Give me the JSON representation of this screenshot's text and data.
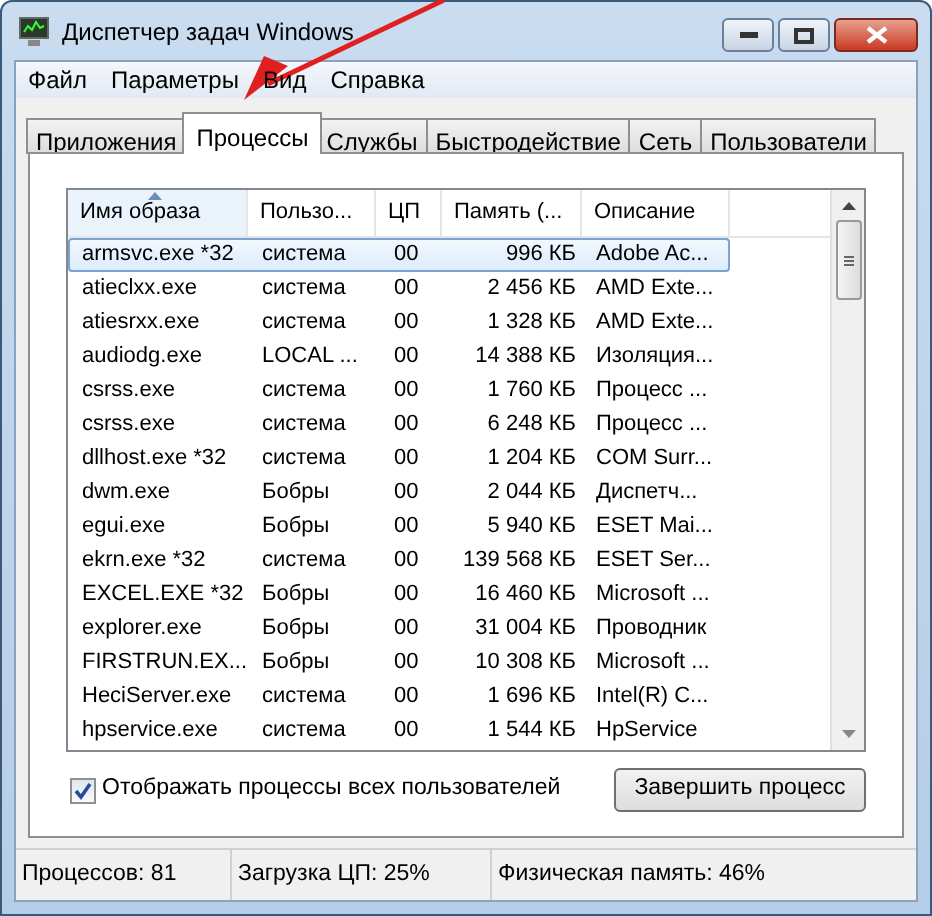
{
  "window": {
    "title": "Диспетчер задач Windows"
  },
  "menu": [
    "Файл",
    "Параметры",
    "Вид",
    "Справка"
  ],
  "tabs": [
    {
      "label": "Приложения",
      "selected": false
    },
    {
      "label": "Процессы",
      "selected": true
    },
    {
      "label": "Службы",
      "selected": false
    },
    {
      "label": "Быстродействие",
      "selected": false
    },
    {
      "label": "Сеть",
      "selected": false
    },
    {
      "label": "Пользователи",
      "selected": false
    }
  ],
  "table": {
    "columns": [
      {
        "label": "Имя образа",
        "sorted": true
      },
      {
        "label": "Пользо...",
        "sorted": false
      },
      {
        "label": "ЦП",
        "sorted": false
      },
      {
        "label": "Память (...",
        "sorted": false
      },
      {
        "label": "Описание",
        "sorted": false
      }
    ],
    "rows": [
      {
        "cells": [
          "armsvc.exe *32",
          "система",
          "00",
          "996 КБ",
          "Adobe Ac..."
        ],
        "selected": true
      },
      {
        "cells": [
          "atieclxx.exe",
          "система",
          "00",
          "2 456 КБ",
          "AMD Exte..."
        ],
        "selected": false
      },
      {
        "cells": [
          "atiesrxx.exe",
          "система",
          "00",
          "1 328 КБ",
          "AMD Exte..."
        ],
        "selected": false
      },
      {
        "cells": [
          "audiodg.exe",
          "LOCAL ...",
          "00",
          "14 388 КБ",
          "Изоляция..."
        ],
        "selected": false
      },
      {
        "cells": [
          "csrss.exe",
          "система",
          "00",
          "1 760 КБ",
          "Процесс ..."
        ],
        "selected": false
      },
      {
        "cells": [
          "csrss.exe",
          "система",
          "00",
          "6 248 КБ",
          "Процесс ..."
        ],
        "selected": false
      },
      {
        "cells": [
          "dllhost.exe *32",
          "система",
          "00",
          "1 204 КБ",
          "COM Surr..."
        ],
        "selected": false
      },
      {
        "cells": [
          "dwm.exe",
          "Бобры",
          "00",
          "2 044 КБ",
          "Диспетч..."
        ],
        "selected": false
      },
      {
        "cells": [
          "egui.exe",
          "Бобры",
          "00",
          "5 940 КБ",
          "ESET Mai..."
        ],
        "selected": false
      },
      {
        "cells": [
          "ekrn.exe *32",
          "система",
          "00",
          "139 568 КБ",
          "ESET Ser..."
        ],
        "selected": false
      },
      {
        "cells": [
          "EXCEL.EXE *32",
          "Бобры",
          "00",
          "16 460 КБ",
          "Microsoft ..."
        ],
        "selected": false
      },
      {
        "cells": [
          "explorer.exe",
          "Бобры",
          "00",
          "31 004 КБ",
          "Проводник"
        ],
        "selected": false
      },
      {
        "cells": [
          "FIRSTRUN.EX...",
          "Бобры",
          "00",
          "10 308 КБ",
          "Microsoft ..."
        ],
        "selected": false
      },
      {
        "cells": [
          "HeciServer.exe",
          "система",
          "00",
          "1 696 КБ",
          "Intel(R) C..."
        ],
        "selected": false
      },
      {
        "cells": [
          "hpservice.exe",
          "система",
          "00",
          "1 544 КБ",
          "HpService"
        ],
        "selected": false
      }
    ]
  },
  "show_all_users": {
    "label": "Отображать процессы всех пользователей",
    "checked": true
  },
  "end_process_button": "Завершить процесс",
  "status_bar": [
    "Процессов: 81",
    "Загрузка ЦП: 25%",
    "Физическая память: 46%"
  ]
}
